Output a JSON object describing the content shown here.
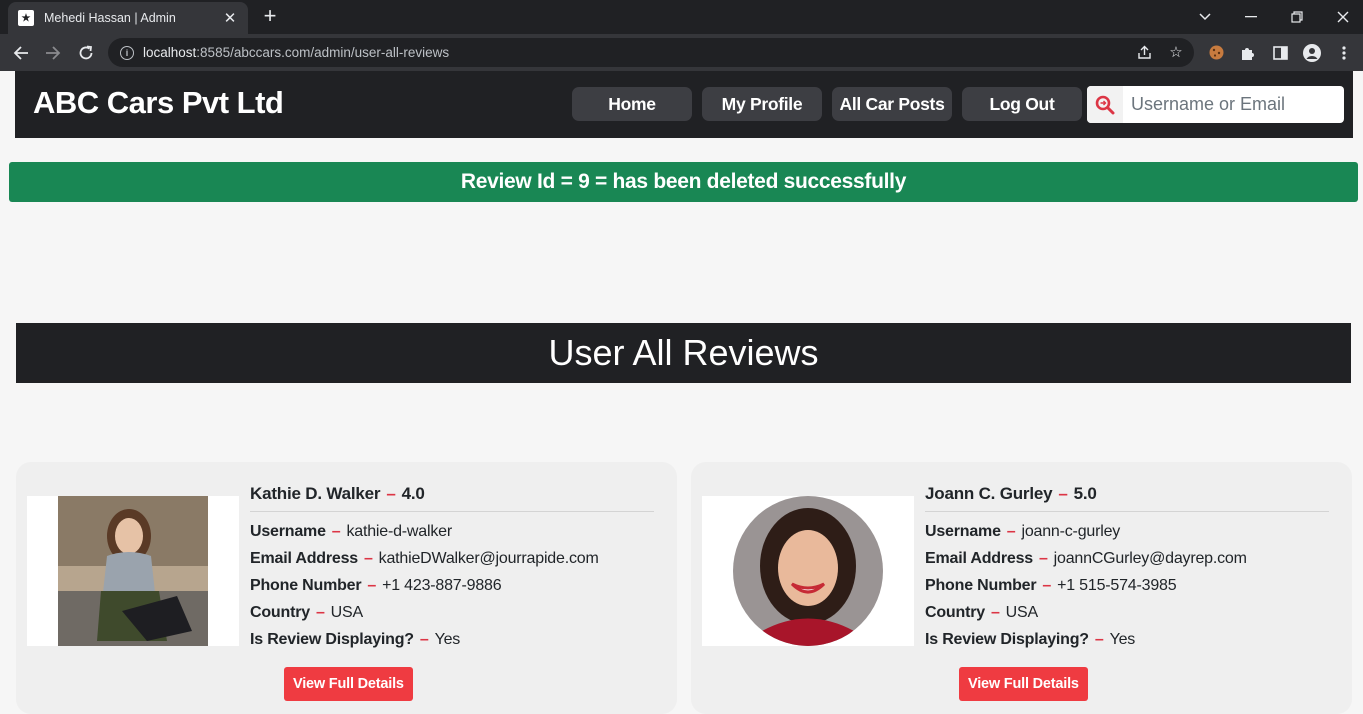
{
  "browser": {
    "tab_title": "Mehedi Hassan | Admin",
    "url_host": "localhost",
    "url_rest": ":8585/abccars.com/admin/user-all-reviews"
  },
  "site": {
    "brand": "ABC Cars Pvt Ltd",
    "nav": [
      {
        "label": "Home"
      },
      {
        "label": "My Profile"
      },
      {
        "label": "All Car Posts"
      },
      {
        "label": "Log Out"
      }
    ],
    "search": {
      "placeholder": "Username or Email",
      "value": ""
    }
  },
  "alert": {
    "message": "Review Id = 9 = has been deleted successfully"
  },
  "page_heading": "User All Reviews",
  "reviews": [
    {
      "name": "Kathie D. Walker",
      "rating": "4.0",
      "fields": [
        {
          "label": "Username",
          "value": "kathie-d-walker"
        },
        {
          "label": "Email Address",
          "value": "kathieDWalker@jourrapide.com"
        },
        {
          "label": "Phone Number",
          "value": "+1 423-887-9886"
        },
        {
          "label": "Country",
          "value": "USA"
        },
        {
          "label": "Is Review Displaying?",
          "value": "Yes"
        }
      ],
      "button": "View Full Details"
    },
    {
      "name": "Joann C. Gurley",
      "rating": "5.0",
      "fields": [
        {
          "label": "Username",
          "value": "joann-c-gurley"
        },
        {
          "label": "Email Address",
          "value": "joannCGurley@dayrep.com"
        },
        {
          "label": "Phone Number",
          "value": "+1 515-574-3985"
        },
        {
          "label": "Country",
          "value": "USA"
        },
        {
          "label": "Is Review Displaying?",
          "value": "Yes"
        }
      ],
      "button": "View Full Details"
    }
  ],
  "colors": {
    "header_bg": "#202124",
    "nav_button_bg": "#3d3e43",
    "alert_bg": "#198754",
    "accent_red": "#dc3545",
    "button_red": "#ef3b41"
  }
}
